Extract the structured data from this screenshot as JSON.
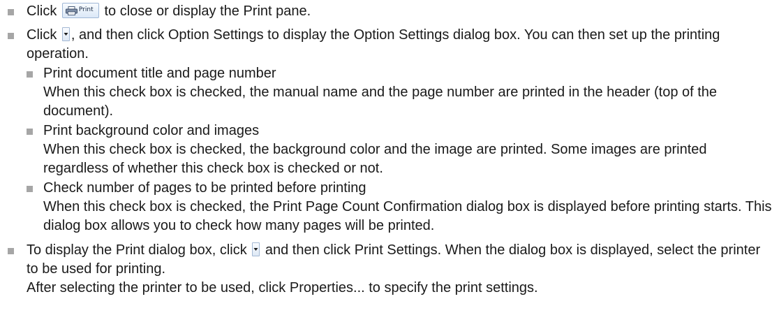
{
  "icons": {
    "print_button": "printer-icon",
    "dropdown_button": "dropdown-arrow-icon",
    "bullet": "square-bullet",
    "bullet_color": "#a6a6a6",
    "button_border_color": "#9fb7d6"
  },
  "print_button": {
    "label": "Print"
  },
  "items": [
    {
      "before": "Click",
      "after": " to close or display the Print pane."
    },
    {
      "before": "Click",
      "after": ", and then click Option Settings to display the Option Settings dialog box. You can then set up the printing operation.",
      "subitems": [
        {
          "title": "Print document title and page number",
          "desc": "When this check box is checked, the manual name and the page number are printed in the header (top of the document)."
        },
        {
          "title": "Print background color and images",
          "desc": "When this check box is checked, the background color and the image are printed. Some images are printed regardless of whether this check box is checked or not."
        },
        {
          "title": "Check number of pages to be printed before printing",
          "desc": "When this check box is checked, the Print Page Count Confirmation dialog box is displayed before printing starts. This dialog box allows you to check how many pages will be printed."
        }
      ]
    },
    {
      "before": "To display the Print dialog box, click",
      "after": " and then click Print Settings. When the dialog box is displayed, select the printer to be used for printing.",
      "extra": "After selecting the printer to be used, click Properties... to specify the print settings."
    }
  ]
}
